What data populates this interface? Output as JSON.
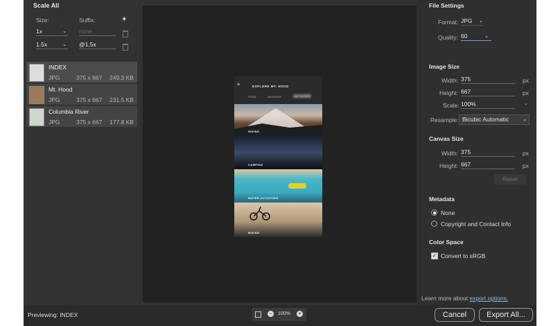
{
  "left": {
    "title": "Scale All",
    "size_label": "Size:",
    "suffix_label": "Suffix:",
    "add_label": "+",
    "scales": [
      {
        "size": "1x",
        "suffix": "",
        "suffix_placeholder": "none"
      },
      {
        "size": "1.5x",
        "suffix": "@1,5x",
        "suffix_placeholder": ""
      }
    ],
    "assets": [
      {
        "name": "INDEX",
        "format": "JPG",
        "dims": "375 x 667",
        "size": "249.3 KB"
      },
      {
        "name": "Mt. Hood",
        "format": "JPG",
        "dims": "375 x 667",
        "size": "231.5 KB"
      },
      {
        "name": "Columbia River",
        "format": "JPG",
        "dims": "375 x 667",
        "size": "177.8 KB"
      }
    ]
  },
  "preview": {
    "header": "EXPLORE MT. HOOD",
    "tabs": [
      "FOOD",
      "WEATHER",
      "ACTIVITIES"
    ],
    "cards": [
      "HIKING",
      "CAMPING",
      "WATER ACTIVITIES",
      "BIKING"
    ]
  },
  "right": {
    "file_settings": {
      "title": "File Settings",
      "format_label": "Format:",
      "format_value": "JPG",
      "quality_label": "Quality:",
      "quality_value": "60"
    },
    "image_size": {
      "title": "Image Size",
      "width_label": "Width:",
      "width_value": "375",
      "height_label": "Height:",
      "height_value": "667",
      "scale_label": "Scale:",
      "scale_value": "100%",
      "resample_label": "Resample:",
      "resample_value": "Bicubic Automatic",
      "unit": "px"
    },
    "canvas_size": {
      "title": "Canvas Size",
      "width_label": "Width:",
      "width_value": "375",
      "height_label": "Height:",
      "height_value": "667",
      "unit": "px",
      "reset_label": "Reset"
    },
    "metadata": {
      "title": "Metadata",
      "option_none": "None",
      "option_copyright": "Copyright and Contact Info",
      "selected": "None"
    },
    "color_space": {
      "title": "Color Space",
      "convert_label": "Convert to sRGB",
      "checked": true
    }
  },
  "bottom": {
    "previewing_label": "Previewing:",
    "previewing_value": "INDEX",
    "zoom": "100%",
    "learn_text": "Learn more about",
    "learn_link": "export options.",
    "cancel_label": "Cancel",
    "export_label": "Export All..."
  },
  "colors": {
    "panel": "#323232",
    "canvas": "#222222",
    "accent_link": "#8fb4e0"
  }
}
